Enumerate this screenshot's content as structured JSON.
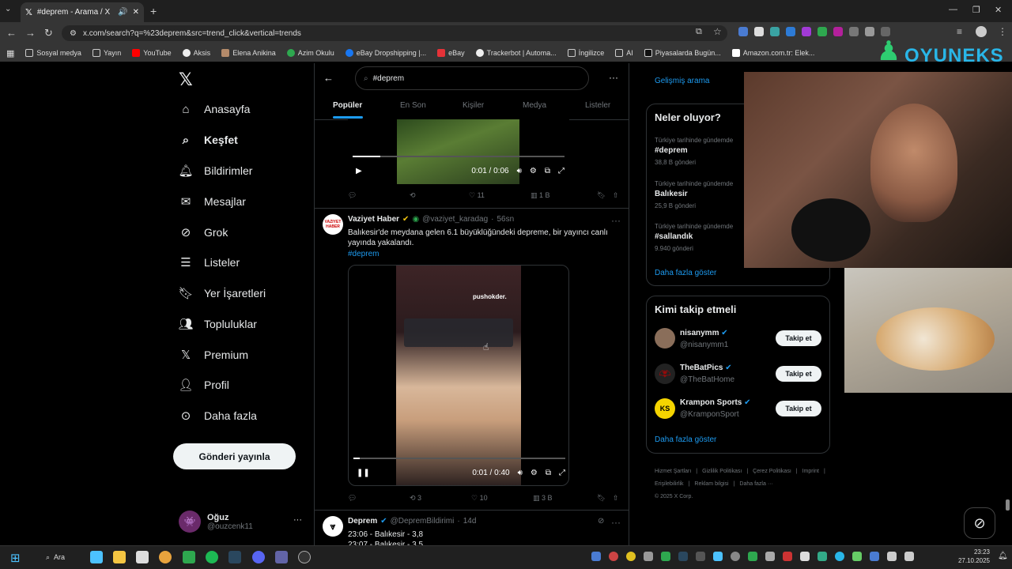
{
  "browser": {
    "tab_title": "#deprem - Arama / X",
    "url": "x.com/search?q=%23deprem&src=trend_click&vertical=trends",
    "bookmarks": [
      "Sosyal medya",
      "Yayın",
      "YouTube",
      "Aksis",
      "Elena Anikina",
      "Azim Okulu",
      "eBay Dropshipping |...",
      "eBay",
      "Trackerbot | Automa...",
      "İngilizce",
      "AI",
      "Piyasalarda Bugün...",
      "Amazon.com.tr: Elek..."
    ]
  },
  "nav": {
    "items": [
      {
        "label": "Anasayfa",
        "icon": "home-icon"
      },
      {
        "label": "Keşfet",
        "icon": "search-icon"
      },
      {
        "label": "Bildirimler",
        "icon": "bell-icon"
      },
      {
        "label": "Mesajlar",
        "icon": "mail-icon"
      },
      {
        "label": "Grok",
        "icon": "grok-icon"
      },
      {
        "label": "Listeler",
        "icon": "list-icon"
      },
      {
        "label": "Yer İşaretleri",
        "icon": "bookmark-icon"
      },
      {
        "label": "Topluluklar",
        "icon": "people-icon"
      },
      {
        "label": "Premium",
        "icon": "x-icon"
      },
      {
        "label": "Profil",
        "icon": "person-icon"
      },
      {
        "label": "Daha fazla",
        "icon": "more-circle-icon"
      }
    ],
    "post_button": "Gönderi yayınla",
    "account": {
      "name": "Oğuz",
      "handle": "@ouzcenk11"
    }
  },
  "search": {
    "query": "#deprem"
  },
  "tabs": [
    "Popüler",
    "En Son",
    "Kişiler",
    "Medya",
    "Listeler"
  ],
  "tweets": [
    {
      "video_time": "0:01 / 0:06",
      "stats": {
        "replies": "",
        "retweets": "",
        "likes": "11",
        "views": "1 B"
      }
    },
    {
      "author": "Vaziyet Haber",
      "handle": "@vaziyet_karadag",
      "time": "56sn",
      "avatar_text": "VAZIYET HABER",
      "text": "Balıkesir'de meydana gelen 6.1 büyüklüğündeki depreme, bir yayıncı canlı yayında yakalandı.",
      "hashtag": "#deprem",
      "video_overlay": "pushokder.",
      "video_time": "0:01 / 0:40",
      "stats": {
        "replies": "",
        "retweets": "3",
        "likes": "10",
        "views": "3 B"
      }
    },
    {
      "author": "Deprem",
      "handle": "@DepremBildirimi",
      "time": "14d",
      "line1": "23:06 - Balıkesir - 3,8",
      "line2": "23:07 - Balıkesir - 3,5"
    }
  ],
  "right": {
    "advanced_search": "Gelişmiş arama",
    "trends_title": "Neler oluyor?",
    "trends": [
      {
        "context": "Türkiye tarihinde gündemde",
        "name": "#deprem",
        "count": "38,8 B gönderi"
      },
      {
        "context": "Türkiye tarihinde gündemde",
        "name": "Balıkesir",
        "count": "25,9 B gönderi"
      },
      {
        "context": "Türkiye tarihinde gündemde",
        "name": "#sallandık",
        "count": "9.940 gönderi"
      }
    ],
    "show_more": "Daha fazla göster",
    "follow_title": "Kimi takip etmeli",
    "follow": [
      {
        "name": "nisanymm",
        "handle": "@nisanymm1",
        "color": "#8a6e5a"
      },
      {
        "name": "TheBatPics",
        "handle": "@TheBatHome",
        "color": "#222222"
      },
      {
        "name": "Krampon Sports",
        "handle": "@KramponSport",
        "color": "#f5d400"
      }
    ],
    "follow_button": "Takip et",
    "footer": [
      "Hizmet Şartları",
      "|",
      "Gizlilik Politikası",
      "|",
      "Çerez Politikası",
      "|",
      "Imprint",
      "|",
      "Erişilebilirlik",
      "|",
      "Reklam bilgisi",
      "|",
      "Daha fazla ···",
      "© 2025 X Corp."
    ]
  },
  "overlay_brand": "OYUNEKS",
  "taskbar": {
    "search": "Ara",
    "time": "23:23",
    "date": "27.10.2025"
  },
  "colors": {
    "accent": "#1d9bf0",
    "bg": "#000000"
  }
}
